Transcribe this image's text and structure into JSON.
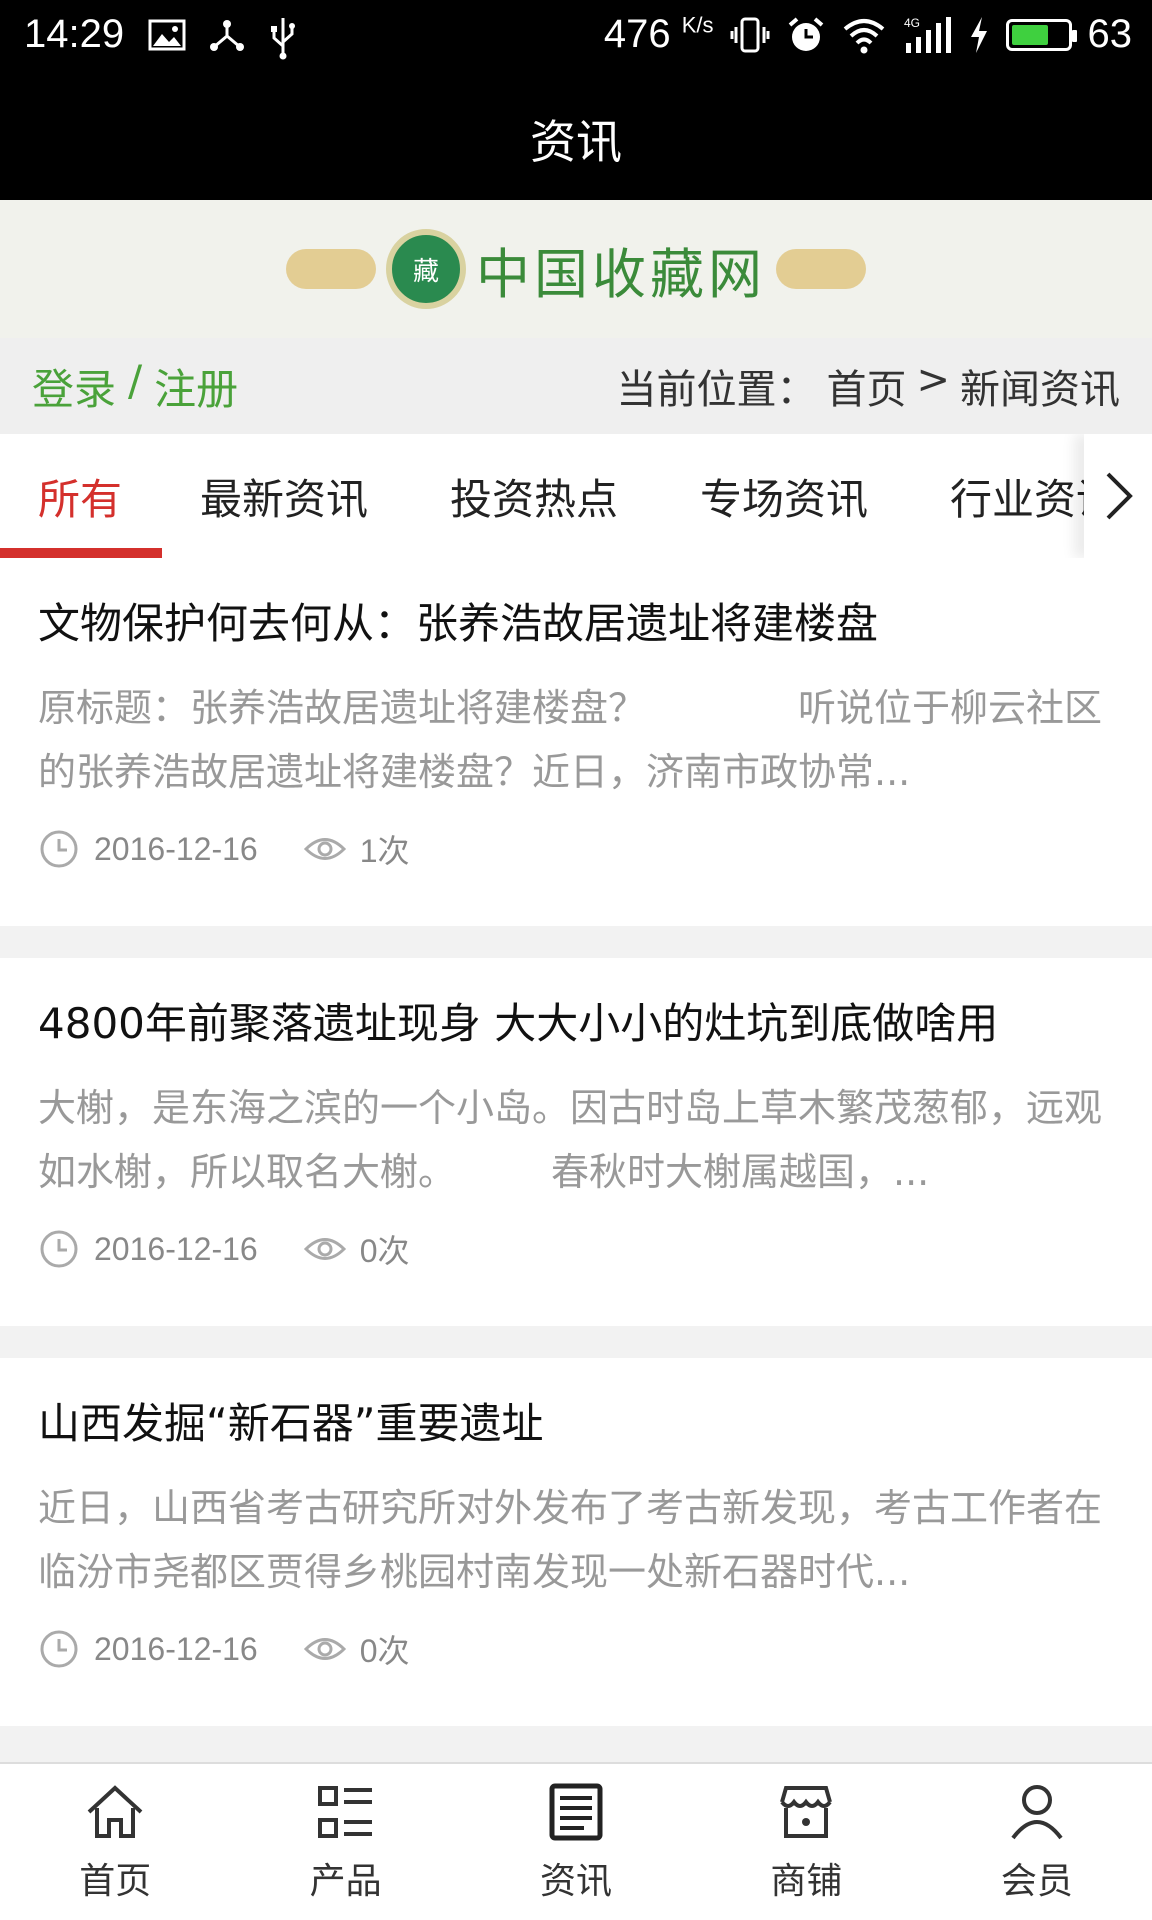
{
  "status_bar": {
    "time": "14:29",
    "speed": "476",
    "speed_unit": "K/s",
    "battery": "63",
    "icons": [
      "image-icon",
      "share-icon",
      "usb-icon",
      "vibrate-icon",
      "alarm-icon",
      "wifi-icon",
      "signal-4g-icon",
      "charging-icon",
      "battery-icon"
    ]
  },
  "title_bar": {
    "title": "资讯"
  },
  "banner": {
    "logo_text": "中国收藏网",
    "seal_char": "藏"
  },
  "login_bar": {
    "login": "登录",
    "separator": "/",
    "register": "注册",
    "breadcrumb_label": "当前位置：",
    "breadcrumb_home": "首页",
    "breadcrumb_arrow": ">",
    "breadcrumb_current": "新闻资讯"
  },
  "tabs": [
    {
      "label": "所有",
      "active": true
    },
    {
      "label": "最新资讯",
      "active": false
    },
    {
      "label": "投资热点",
      "active": false
    },
    {
      "label": "专场资讯",
      "active": false
    },
    {
      "label": "行业资讯",
      "active": false
    }
  ],
  "articles": [
    {
      "title": "文物保护何去何从：张养浩故居遗址将建楼盘",
      "summary": "原标题：张养浩故居遗址将建楼盘？　　　　听说位于柳云社区的张养浩故居遗址将建楼盘？近日，济南市政协常...",
      "date": "2016-12-16",
      "views": "1次"
    },
    {
      "title": "4800年前聚落遗址现身 大大小小的灶坑到底做啥用",
      "summary": "大榭，是东海之滨的一个小岛。因古时岛上草木繁茂葱郁，远观如水榭，所以取名大榭。　　　春秋时大榭属越国，...",
      "date": "2016-12-16",
      "views": "0次"
    },
    {
      "title": "山西发掘“新石器”重要遗址",
      "summary": "近日，山西省考古研究所对外发布了考古新发现，考古工作者在临汾市尧都区贾得乡桃园村南发现一处新石器时代...",
      "date": "2016-12-16",
      "views": "0次"
    }
  ],
  "bottom_nav": [
    {
      "label": "首页",
      "icon": "home-icon"
    },
    {
      "label": "产品",
      "icon": "products-icon"
    },
    {
      "label": "资讯",
      "icon": "news-icon"
    },
    {
      "label": "商铺",
      "icon": "shop-icon"
    },
    {
      "label": "会员",
      "icon": "member-icon"
    }
  ],
  "colors": {
    "accent_red": "#d4302c",
    "login_green": "#4aa23a",
    "logo_green": "#3b8b3a"
  }
}
